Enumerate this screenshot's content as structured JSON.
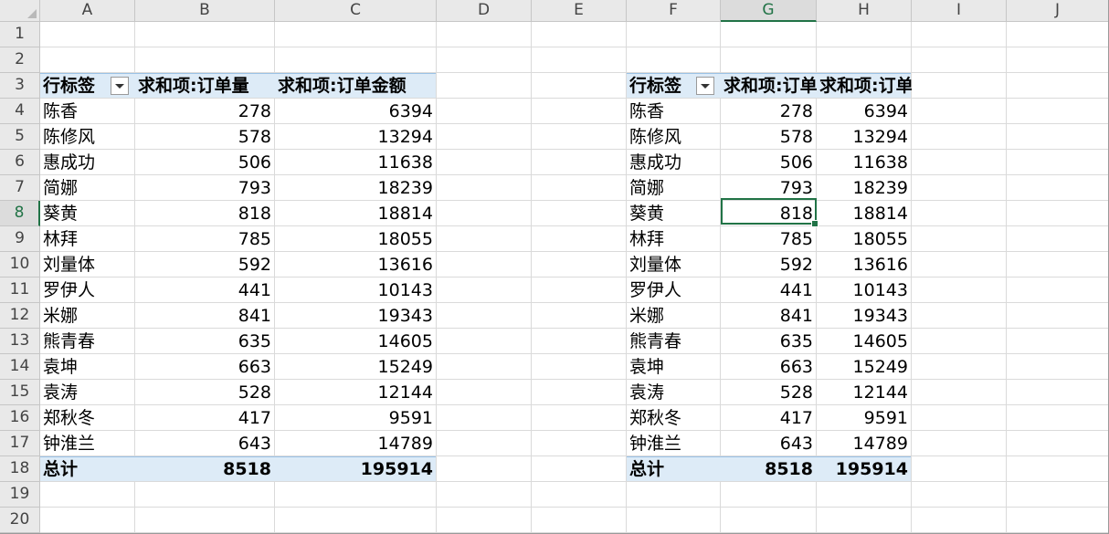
{
  "colors": {
    "accent": "#217346",
    "pivot_band": "#ddebf7",
    "header_bg": "#e9e9e9",
    "grid": "#dadada"
  },
  "columns": [
    "A",
    "B",
    "C",
    "D",
    "E",
    "F",
    "G",
    "H",
    "I",
    "J"
  ],
  "active_column": "G",
  "active_row": "8",
  "rows": [
    "1",
    "2",
    "3",
    "4",
    "5",
    "6",
    "7",
    "8",
    "9",
    "10",
    "11",
    "12",
    "13",
    "14",
    "15",
    "16",
    "17",
    "18",
    "19",
    "20"
  ],
  "pivot_left": {
    "headers": [
      "行标签",
      "求和项:订单量",
      "求和项:订单金额"
    ],
    "records": [
      [
        "陈香",
        "278",
        "6394"
      ],
      [
        "陈修风",
        "578",
        "13294"
      ],
      [
        "惠成功",
        "506",
        "11638"
      ],
      [
        "简娜",
        "793",
        "18239"
      ],
      [
        "葵黄",
        "818",
        "18814"
      ],
      [
        "林拜",
        "785",
        "18055"
      ],
      [
        "刘量体",
        "592",
        "13616"
      ],
      [
        "罗伊人",
        "441",
        "10143"
      ],
      [
        "米娜",
        "841",
        "19343"
      ],
      [
        "熊青春",
        "635",
        "14605"
      ],
      [
        "袁坤",
        "663",
        "15249"
      ],
      [
        "袁涛",
        "528",
        "12144"
      ],
      [
        "郑秋冬",
        "417",
        "9591"
      ],
      [
        "钟淮兰",
        "643",
        "14789"
      ]
    ],
    "total": [
      "总计",
      "8518",
      "195914"
    ]
  },
  "pivot_right": {
    "headers": [
      "行标签",
      "求和项:订单量",
      "求和项:订单金额"
    ],
    "records": [
      [
        "陈香",
        "278",
        "6394"
      ],
      [
        "陈修风",
        "578",
        "13294"
      ],
      [
        "惠成功",
        "506",
        "11638"
      ],
      [
        "简娜",
        "793",
        "18239"
      ],
      [
        "葵黄",
        "818",
        "18814"
      ],
      [
        "林拜",
        "785",
        "18055"
      ],
      [
        "刘量体",
        "592",
        "13616"
      ],
      [
        "罗伊人",
        "441",
        "10143"
      ],
      [
        "米娜",
        "841",
        "19343"
      ],
      [
        "熊青春",
        "635",
        "14605"
      ],
      [
        "袁坤",
        "663",
        "15249"
      ],
      [
        "袁涛",
        "528",
        "12144"
      ],
      [
        "郑秋冬",
        "417",
        "9591"
      ],
      [
        "钟淮兰",
        "643",
        "14789"
      ]
    ],
    "total": [
      "总计",
      "8518",
      "195914"
    ]
  }
}
